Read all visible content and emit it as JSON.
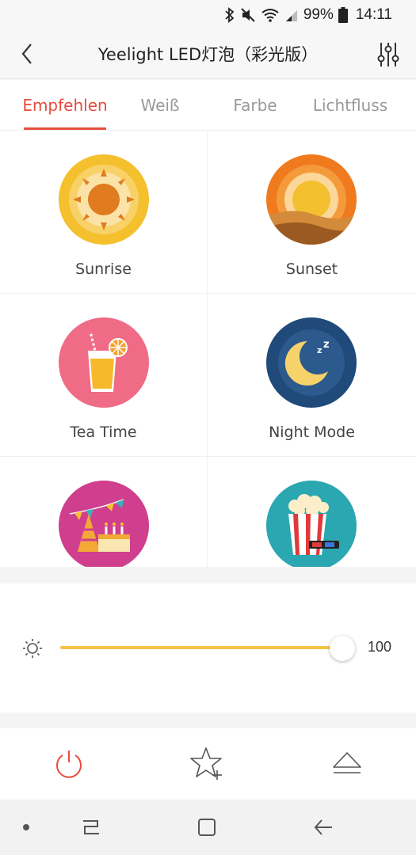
{
  "status_bar": {
    "battery_percent": "99%",
    "time": "14:11",
    "icons": [
      "bluetooth-icon",
      "mute-icon",
      "wifi-icon",
      "signal-icon",
      "battery-icon"
    ]
  },
  "header": {
    "title": "Yeelight LED灯泡（彩光版）",
    "back_icon": "chevron-left-icon",
    "settings_icon": "sliders-icon"
  },
  "tabs": [
    {
      "label": "Empfehlen",
      "active": true
    },
    {
      "label": "Weiß",
      "active": false
    },
    {
      "label": "Farbe",
      "active": false
    },
    {
      "label": "Lichtfluss",
      "active": false
    }
  ],
  "scenes": [
    {
      "label": "Sunrise",
      "icon": "sunrise-icon"
    },
    {
      "label": "Sunset",
      "icon": "sunset-icon"
    },
    {
      "label": "Tea Time",
      "icon": "tea-time-icon"
    },
    {
      "label": "Night Mode",
      "icon": "night-mode-icon"
    },
    {
      "label": "",
      "icon": "party-icon"
    },
    {
      "label": "",
      "icon": "movie-icon"
    }
  ],
  "brightness": {
    "value": "100",
    "level_percent": 100,
    "icon": "sun-icon"
  },
  "bottom_bar": {
    "items": [
      "power-icon",
      "favorite-add-icon",
      "eject-icon"
    ]
  },
  "colors": {
    "accent": "#e84c3d",
    "slider": "#f5c445"
  }
}
